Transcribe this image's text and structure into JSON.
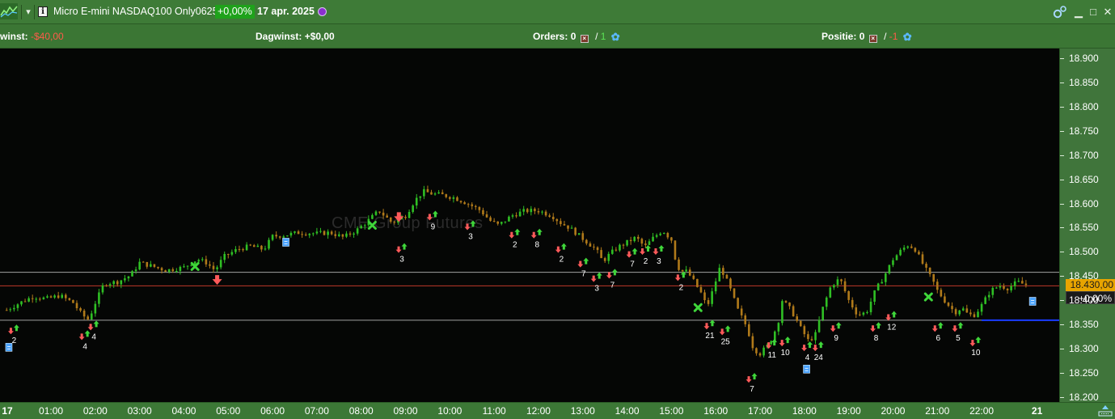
{
  "window": {
    "instrument": "Micro E-mini NASDAQ100 Only0625",
    "change": "+0,00%",
    "date": "17 apr. 2025",
    "minimize_label": "▁",
    "maximize_label": "□",
    "close_label": "✕"
  },
  "status": {
    "winst_label": "winst:",
    "winst_value": "-$40,00",
    "dagwinst_label": "Dagwinst:",
    "dagwinst_value": "+$0,00",
    "orders_label": "Orders:",
    "orders_value": "0",
    "orders_sep": "/",
    "orders_count": "1",
    "positie_label": "Positie:",
    "positie_value": "0",
    "positie_sep": "/",
    "positie_count": "-1"
  },
  "watermark": "CME Group Futures",
  "colors": {
    "up": "#2fbf24",
    "down": "#b07a1a",
    "buy_arrow": "#3fd63a",
    "sell_arrow": "#ff5a5a",
    "exit_marker": "#3fd63a",
    "note_icon": "#4aa3ff",
    "last_price_line": "#c0392b",
    "reference_line": "#bdbdbd",
    "order_line": "#1a3cff",
    "price_box": "#e8a400"
  },
  "chart_data": {
    "type": "candlestick",
    "ylim": [
      18190,
      18920
    ],
    "y_ticks": [
      "18.900",
      "18.850",
      "18.800",
      "18.750",
      "18.700",
      "18.650",
      "18.600",
      "18.550",
      "18.500",
      "18.450",
      "18.400",
      "18.350",
      "18.300",
      "18.250",
      "18.200"
    ],
    "y_tick_values": [
      18900,
      18850,
      18800,
      18750,
      18700,
      18650,
      18600,
      18550,
      18500,
      18450,
      18400,
      18350,
      18300,
      18250,
      18200
    ],
    "x_ticks": [
      "17",
      "01:00",
      "02:00",
      "03:00",
      "04:00",
      "05:00",
      "06:00",
      "07:00",
      "08:00",
      "09:00",
      "10:00",
      "11:00",
      "12:00",
      "13:00",
      "14:00",
      "15:00",
      "16:00",
      "17:00",
      "18:00",
      "19:00",
      "20:00",
      "21:00",
      "22:00",
      "21"
    ],
    "x_tick_hours": [
      0,
      1,
      2,
      3,
      4,
      5,
      6,
      7,
      8,
      9,
      10,
      11,
      12,
      13,
      14,
      15,
      16,
      17,
      18,
      19,
      20,
      21,
      22,
      23.25
    ],
    "x_range_hours": [
      -0.15,
      23.75
    ],
    "last_price": 18430,
    "last_price_label": "18.430,00",
    "change_label": "+0,00%",
    "reference_lines": [
      18458,
      18359
    ],
    "order_line": {
      "price": 18359,
      "from_hour": 22.0,
      "to_hour": 23.75
    },
    "price_path": [
      [
        0.0,
        18380
      ],
      [
        0.3,
        18395
      ],
      [
        0.6,
        18408
      ],
      [
        0.9,
        18403
      ],
      [
        1.2,
        18410
      ],
      [
        1.5,
        18395
      ],
      [
        1.7,
        18370
      ],
      [
        1.85,
        18360
      ],
      [
        2.0,
        18395
      ],
      [
        2.2,
        18435
      ],
      [
        2.5,
        18438
      ],
      [
        2.8,
        18452
      ],
      [
        3.0,
        18478
      ],
      [
        3.3,
        18470
      ],
      [
        3.6,
        18462
      ],
      [
        4.0,
        18468
      ],
      [
        4.3,
        18485
      ],
      [
        4.5,
        18478
      ],
      [
        4.7,
        18462
      ],
      [
        4.9,
        18490
      ],
      [
        5.2,
        18505
      ],
      [
        5.5,
        18512
      ],
      [
        5.8,
        18505
      ],
      [
        6.0,
        18532
      ],
      [
        6.3,
        18535
      ],
      [
        6.6,
        18540
      ],
      [
        7.0,
        18538
      ],
      [
        7.3,
        18540
      ],
      [
        7.6,
        18530
      ],
      [
        7.9,
        18545
      ],
      [
        8.1,
        18560
      ],
      [
        8.4,
        18585
      ],
      [
        8.7,
        18560
      ],
      [
        9.0,
        18575
      ],
      [
        9.2,
        18605
      ],
      [
        9.4,
        18625
      ],
      [
        9.6,
        18620
      ],
      [
        9.8,
        18618
      ],
      [
        10.1,
        18612
      ],
      [
        10.4,
        18600
      ],
      [
        10.7,
        18585
      ],
      [
        10.9,
        18565
      ],
      [
        11.1,
        18555
      ],
      [
        11.4,
        18575
      ],
      [
        11.7,
        18585
      ],
      [
        12.0,
        18585
      ],
      [
        12.3,
        18575
      ],
      [
        12.5,
        18560
      ],
      [
        12.7,
        18550
      ],
      [
        12.9,
        18535
      ],
      [
        13.1,
        18520
      ],
      [
        13.3,
        18505
      ],
      [
        13.45,
        18480
      ],
      [
        13.6,
        18495
      ],
      [
        13.8,
        18510
      ],
      [
        14.0,
        18520
      ],
      [
        14.2,
        18530
      ],
      [
        14.4,
        18510
      ],
      [
        14.6,
        18530
      ],
      [
        14.8,
        18545
      ],
      [
        15.0,
        18525
      ],
      [
        15.1,
        18480
      ],
      [
        15.2,
        18460
      ],
      [
        15.35,
        18460
      ],
      [
        15.5,
        18440
      ],
      [
        15.7,
        18410
      ],
      [
        15.8,
        18385
      ],
      [
        15.95,
        18425
      ],
      [
        16.1,
        18470
      ],
      [
        16.3,
        18430
      ],
      [
        16.5,
        18380
      ],
      [
        16.7,
        18345
      ],
      [
        16.85,
        18300
      ],
      [
        17.0,
        18290
      ],
      [
        17.2,
        18310
      ],
      [
        17.4,
        18350
      ],
      [
        17.5,
        18400
      ],
      [
        17.7,
        18380
      ],
      [
        17.9,
        18345
      ],
      [
        18.1,
        18315
      ],
      [
        18.25,
        18330
      ],
      [
        18.4,
        18380
      ],
      [
        18.6,
        18430
      ],
      [
        18.8,
        18445
      ],
      [
        19.0,
        18400
      ],
      [
        19.2,
        18370
      ],
      [
        19.4,
        18375
      ],
      [
        19.6,
        18420
      ],
      [
        19.8,
        18450
      ],
      [
        20.0,
        18485
      ],
      [
        20.2,
        18505
      ],
      [
        20.35,
        18515
      ],
      [
        20.5,
        18505
      ],
      [
        20.7,
        18470
      ],
      [
        20.9,
        18440
      ],
      [
        21.0,
        18420
      ],
      [
        21.2,
        18395
      ],
      [
        21.4,
        18375
      ],
      [
        21.55,
        18385
      ],
      [
        21.7,
        18370
      ],
      [
        21.85,
        18370
      ],
      [
        22.0,
        18390
      ],
      [
        22.2,
        18420
      ],
      [
        22.4,
        18430
      ],
      [
        22.6,
        18425
      ],
      [
        22.8,
        18438
      ],
      [
        23.0,
        18432
      ]
    ],
    "signals": [
      {
        "hour": 0.15,
        "price": 18350,
        "arrows": "both",
        "label": "2"
      },
      {
        "hour": 1.75,
        "price": 18338,
        "arrows": "both",
        "label": "4"
      },
      {
        "hour": 1.95,
        "price": 18358,
        "arrows": "both",
        "label": "4"
      },
      {
        "hour": 8.9,
        "price": 18518,
        "arrows": "both",
        "label": "3"
      },
      {
        "hour": 9.6,
        "price": 18585,
        "arrows": "both",
        "label": "9"
      },
      {
        "hour": 10.45,
        "price": 18565,
        "arrows": "both",
        "label": "3"
      },
      {
        "hour": 11.45,
        "price": 18548,
        "arrows": "both",
        "label": "2"
      },
      {
        "hour": 11.95,
        "price": 18548,
        "arrows": "both",
        "label": "8"
      },
      {
        "hour": 12.5,
        "price": 18518,
        "arrows": "both",
        "label": "2"
      },
      {
        "hour": 13.0,
        "price": 18488,
        "arrows": "both",
        "label": "7"
      },
      {
        "hour": 13.3,
        "price": 18458,
        "arrows": "both",
        "label": "3"
      },
      {
        "hour": 13.65,
        "price": 18465,
        "arrows": "both",
        "label": "7"
      },
      {
        "hour": 14.1,
        "price": 18508,
        "arrows": "both",
        "label": "7"
      },
      {
        "hour": 14.4,
        "price": 18514,
        "arrows": "both",
        "label": "2"
      },
      {
        "hour": 14.7,
        "price": 18514,
        "arrows": "both",
        "label": "3"
      },
      {
        "hour": 15.2,
        "price": 18460,
        "arrows": "both",
        "label": "2"
      },
      {
        "hour": 15.85,
        "price": 18360,
        "arrows": "both",
        "label": "21"
      },
      {
        "hour": 16.2,
        "price": 18348,
        "arrows": "both",
        "label": "25"
      },
      {
        "hour": 16.8,
        "price": 18250,
        "arrows": "both",
        "label": "7"
      },
      {
        "hour": 17.25,
        "price": 18320,
        "arrows": "both",
        "label": "11"
      },
      {
        "hour": 17.55,
        "price": 18325,
        "arrows": "both",
        "label": "10"
      },
      {
        "hour": 18.05,
        "price": 18315,
        "arrows": "both",
        "label": "4"
      },
      {
        "hour": 18.3,
        "price": 18315,
        "arrows": "both",
        "label": "24"
      },
      {
        "hour": 18.7,
        "price": 18355,
        "arrows": "both",
        "label": "9"
      },
      {
        "hour": 19.6,
        "price": 18355,
        "arrows": "both",
        "label": "8"
      },
      {
        "hour": 19.95,
        "price": 18378,
        "arrows": "both",
        "label": "12"
      },
      {
        "hour": 21.0,
        "price": 18355,
        "arrows": "both",
        "label": "6"
      },
      {
        "hour": 21.45,
        "price": 18355,
        "arrows": "both",
        "label": "5"
      },
      {
        "hour": 21.85,
        "price": 18325,
        "arrows": "both",
        "label": "10"
      }
    ],
    "big_sells": [
      {
        "hour": 4.75,
        "price": 18452
      },
      {
        "hour": 8.85,
        "price": 18582
      }
    ],
    "exits": [
      {
        "hour": 4.25,
        "price": 18470
      },
      {
        "hour": 8.25,
        "price": 18555
      },
      {
        "hour": 15.6,
        "price": 18385
      },
      {
        "hour": 20.8,
        "price": 18407
      }
    ],
    "notes": [
      {
        "hour": 0.05,
        "price": 18303
      },
      {
        "hour": 6.3,
        "price": 18520
      },
      {
        "hour": 18.05,
        "price": 18258
      },
      {
        "hour": 23.15,
        "price": 18398
      }
    ]
  }
}
